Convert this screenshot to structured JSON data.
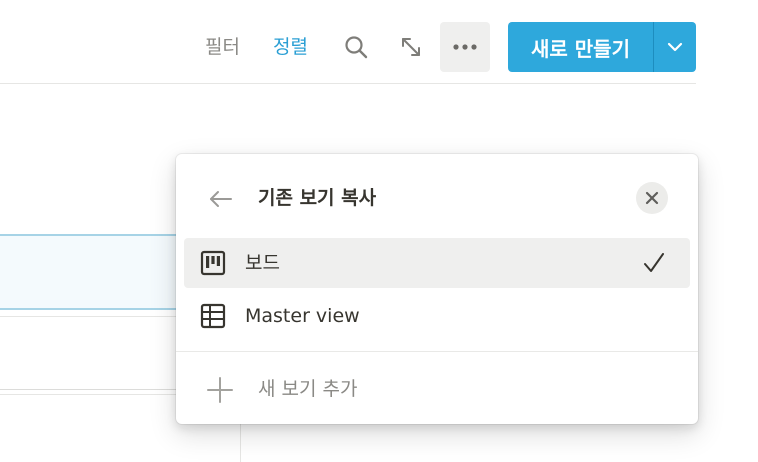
{
  "toolbar": {
    "filter_label": "필터",
    "sort_label": "정렬",
    "icons": [
      "search-icon",
      "expand-icon",
      "more-icon"
    ],
    "new_button_label": "새로 만들기",
    "accent_color": "#2ea8dc"
  },
  "popup": {
    "title": "기존 보기 복사",
    "views": [
      {
        "label": "보드",
        "icon": "board-icon",
        "selected": true
      },
      {
        "label": "Master view",
        "icon": "table-icon",
        "selected": false
      }
    ],
    "add_view_label": "새 보기 추가"
  }
}
